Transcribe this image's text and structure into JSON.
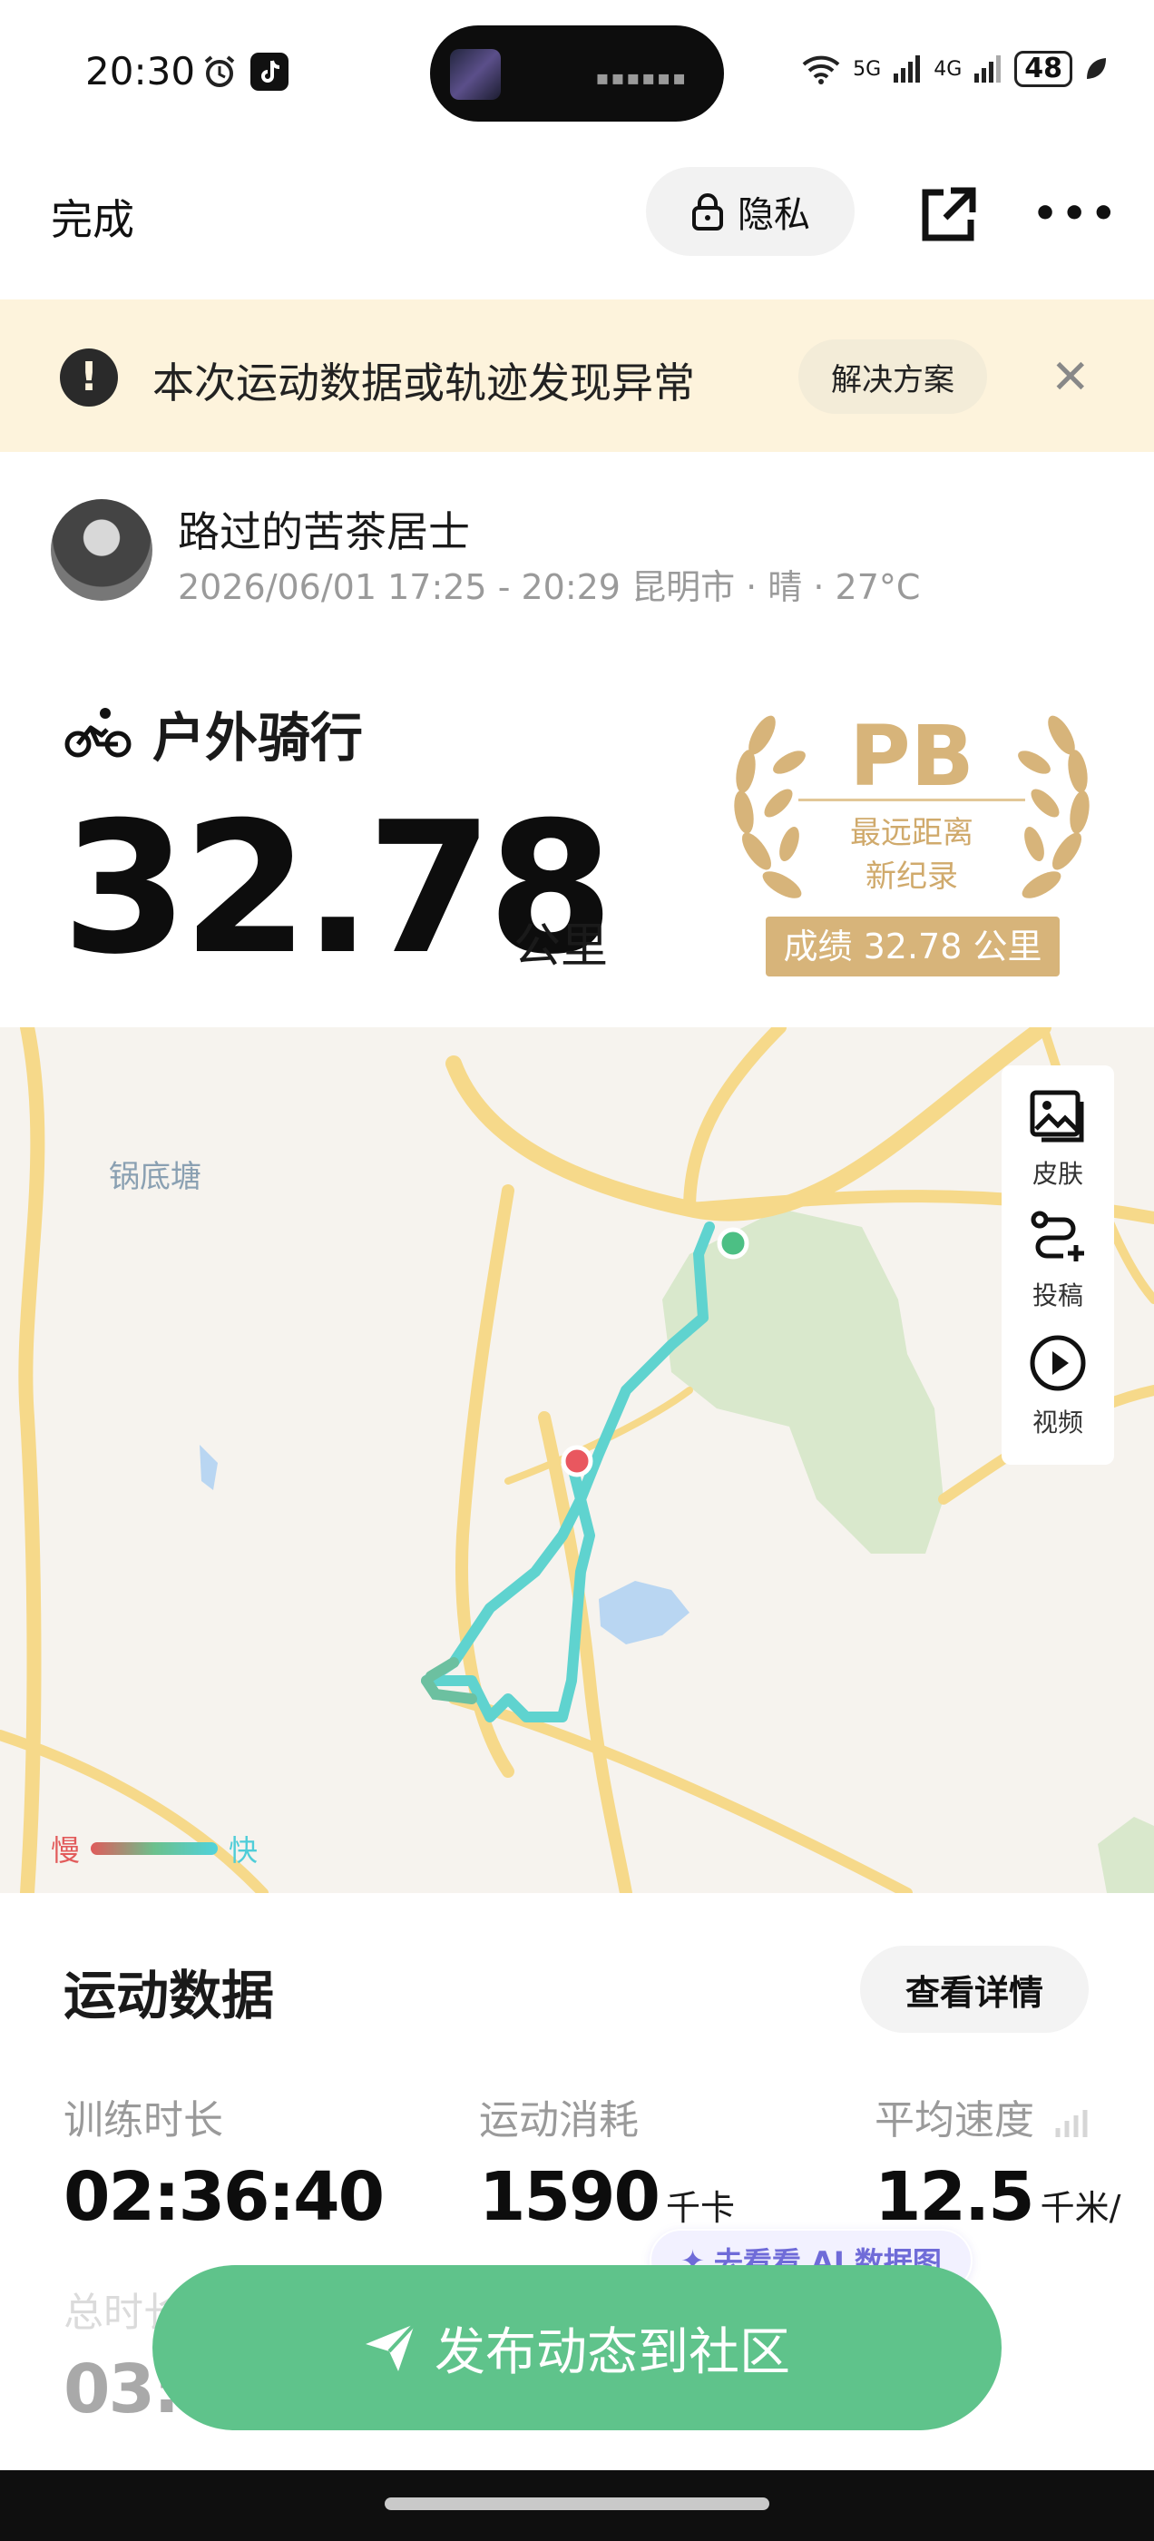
{
  "status_bar": {
    "time": "20:30",
    "signal_5g": "5G",
    "signal_4g": "4G",
    "battery": "48"
  },
  "nav": {
    "done": "完成",
    "privacy": "隐私"
  },
  "banner": {
    "text": "本次运动数据或轨迹发现异常",
    "action": "解决方案"
  },
  "user": {
    "name": "路过的苦茶居士",
    "meta": "2026/06/01 17:25 - 20:29 昆明市 · 晴 · 27°C"
  },
  "activity": {
    "type": "户外骑行",
    "distance": "32.78",
    "unit": "公里"
  },
  "pb": {
    "title": "PB",
    "line1": "最远距离",
    "line2": "新纪录",
    "result": "成绩 32.78 公里"
  },
  "map": {
    "place_label": "锅底塘",
    "tools": [
      {
        "label": "皮肤",
        "icon": "image-icon"
      },
      {
        "label": "投稿",
        "icon": "route-add-icon"
      },
      {
        "label": "视频",
        "icon": "play-icon"
      }
    ],
    "legend": {
      "slow": "慢",
      "fast": "快"
    },
    "colors": {
      "track": "#5fd3cf",
      "start": "#4cbf84",
      "end": "#e9575f",
      "park": "#d9e8cc",
      "road": "#f6d98a"
    }
  },
  "stats": {
    "title": "运动数据",
    "details_button": "查看详情",
    "items": [
      {
        "label": "训练时长",
        "value": "02:36:40",
        "unit": ""
      },
      {
        "label": "运动消耗",
        "value": "1590",
        "unit": "千卡"
      },
      {
        "label": "平均速度",
        "value": "12.5",
        "unit": "千米/时"
      },
      {
        "label": "总时长",
        "value": "03:0"
      }
    ],
    "ai_chip": "去看看 AI 数据图"
  },
  "publish_button": "发布动态到社区"
}
